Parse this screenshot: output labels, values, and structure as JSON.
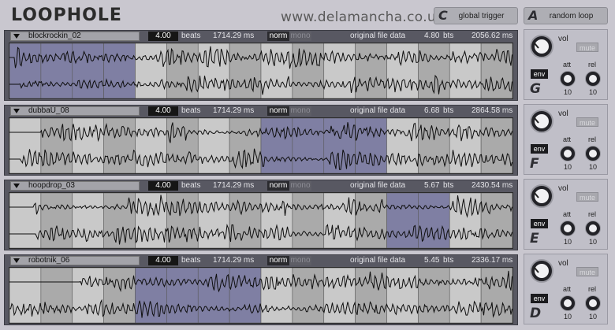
{
  "app": {
    "logo": "LOOPHOLE",
    "site": "www.delamancha.co.uk"
  },
  "buttons": {
    "global_trigger": {
      "key": "C",
      "label": "global trigger"
    },
    "random_loop": {
      "key": "A",
      "label": "random loop"
    }
  },
  "labels": {
    "beats": "beats",
    "original": "original file data",
    "bts": "bts",
    "norm": "norm",
    "mono": "mono",
    "vol": "vol",
    "mute": "mute",
    "env": "env",
    "att": "att",
    "rel": "rel"
  },
  "tracks": [
    {
      "name": "blockrockin_02",
      "beats": "4.00",
      "ms": "1714.29 ms",
      "orig_bts": "4.80",
      "orig_ms": "2056.62 ms",
      "key": "G",
      "att": "10",
      "rel": "10",
      "highlight": [
        0,
        4
      ],
      "seed": 3
    },
    {
      "name": "dubbaU_08",
      "beats": "4.00",
      "ms": "1714.29 ms",
      "orig_bts": "6.68",
      "orig_ms": "2864.58 ms",
      "key": "F",
      "att": "10",
      "rel": "10",
      "highlight": [
        8,
        12
      ],
      "seed": 7
    },
    {
      "name": "hoopdrop_03",
      "beats": "4.00",
      "ms": "1714.29 ms",
      "orig_bts": "5.67",
      "orig_ms": "2430.54 ms",
      "key": "E",
      "att": "10",
      "rel": "10",
      "highlight": [
        12,
        14
      ],
      "seed": 11
    },
    {
      "name": "robotnik_06",
      "beats": "4.00",
      "ms": "1714.29 ms",
      "orig_bts": "5.45",
      "orig_ms": "2336.17 ms",
      "key": "D",
      "att": "10",
      "rel": "10",
      "highlight": [
        4,
        8
      ],
      "seed": 19
    }
  ],
  "colors": {
    "highlight": "#7f7fa3",
    "cell_light": "#c9c9c9",
    "cell_dark": "#aaaaaa",
    "wave": "#0e0e0e"
  }
}
